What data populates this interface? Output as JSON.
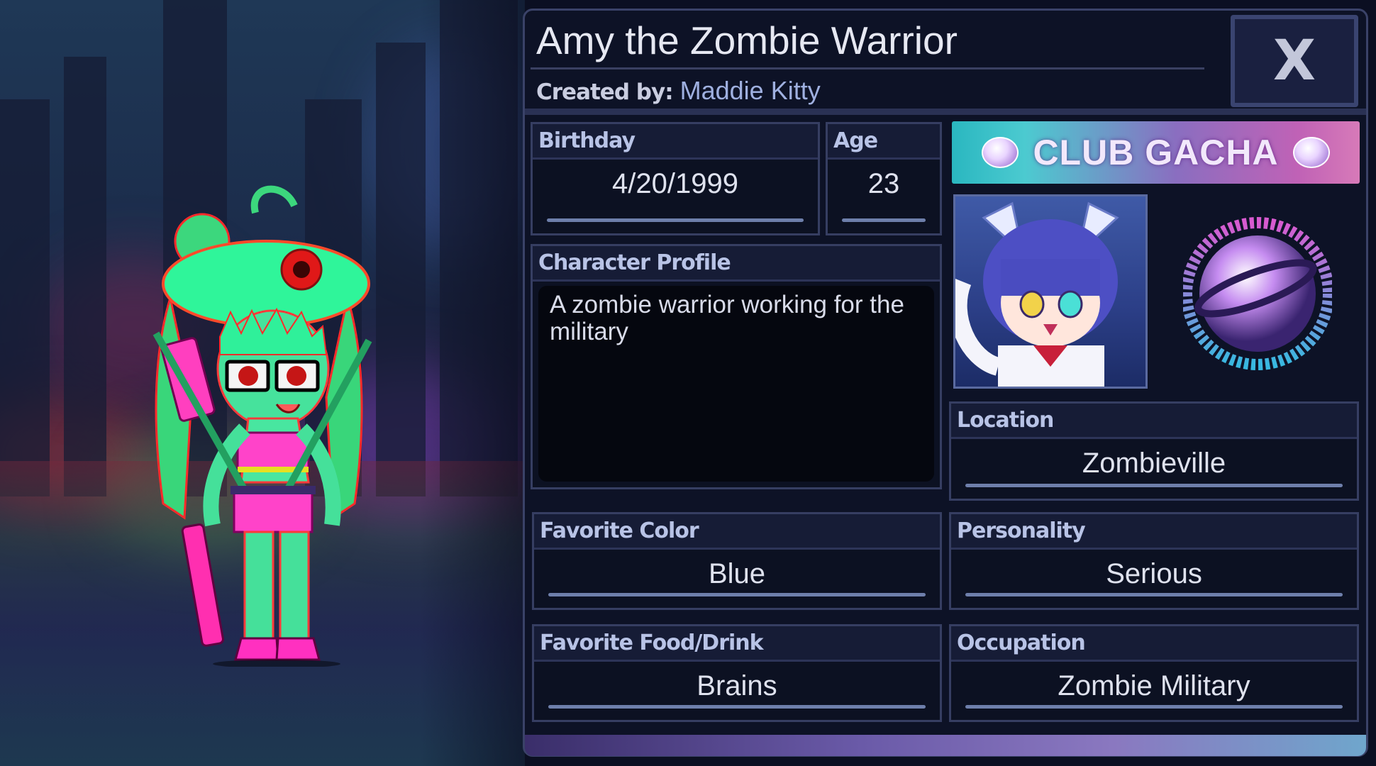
{
  "header": {
    "title": "Amy the Zombie Warrior",
    "created_by_label": "Created by:",
    "created_by_value": "Maddie Kitty",
    "close_label": "X"
  },
  "fields": {
    "birthday": {
      "label": "Birthday",
      "value": "4/20/1999"
    },
    "age": {
      "label": "Age",
      "value": "23"
    },
    "profile": {
      "label": "Character Profile",
      "value": "A zombie warrior working for the military"
    },
    "location": {
      "label": "Location",
      "value": "Zombieville"
    },
    "favorite_color": {
      "label": "Favorite Color",
      "value": "Blue"
    },
    "personality": {
      "label": "Personality",
      "value": "Serious"
    },
    "favorite_food": {
      "label": "Favorite Food/Drink",
      "value": "Brains"
    },
    "occupation": {
      "label": "Occupation",
      "value": "Zombie Military"
    }
  },
  "branding": {
    "logo_text": "CLUB GACHA"
  },
  "colors": {
    "panel_bg": "#0d1226",
    "label_text": "#b8c3e6",
    "value_underline": "#6e7fab",
    "character_skin": "#3fe89a",
    "character_accent": "#ff3fbf"
  },
  "icons": {
    "close": "close-icon",
    "logo_orb": "planet-orb-icon",
    "badge": "audio-orb-badge-icon"
  }
}
